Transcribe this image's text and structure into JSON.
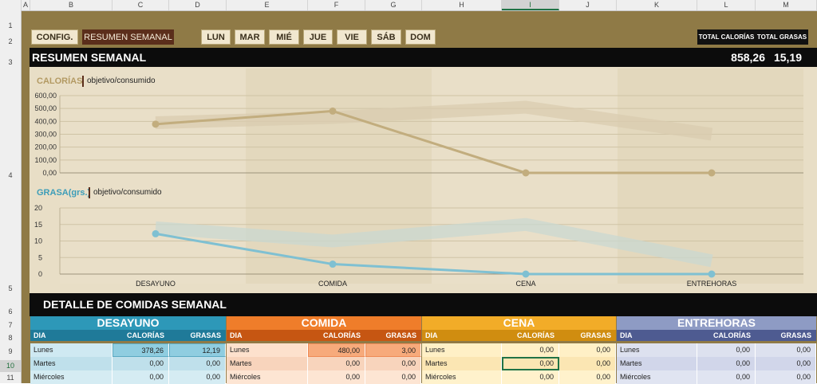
{
  "columns": [
    "A",
    "B",
    "C",
    "D",
    "E",
    "F",
    "G",
    "H",
    "I",
    "J",
    "K",
    "L",
    "M"
  ],
  "rows": [
    "1",
    "2",
    "3",
    "4",
    "5",
    "6",
    "7",
    "8",
    "9",
    "10",
    "11"
  ],
  "nav": {
    "config": "CONFIG.",
    "resumen": "RESUMEN SEMANAL",
    "days": [
      "LUN",
      "MAR",
      "MIÉ",
      "JUE",
      "VIE",
      "SÁB",
      "DOM"
    ]
  },
  "totals": {
    "cal_label": "TOTAL CALORÍAS",
    "fat_label": "TOTAL GRASAS",
    "cal_value": "858,26",
    "fat_value": "15,19"
  },
  "section_title": "RESUMEN SEMANAL",
  "detail_title": "DETALLE DE COMIDAS SEMANAL",
  "chart_data": [
    {
      "type": "line",
      "title": "CALORÍAS",
      "subtitle": "objetivo/consumido",
      "categories": [
        "DESAYUNO",
        "COMIDA",
        "CENA",
        "ENTREHORAS"
      ],
      "ylim": [
        0,
        600
      ],
      "yticks": [
        "0,00",
        "100,00",
        "200,00",
        "300,00",
        "400,00",
        "500,00",
        "600,00"
      ],
      "grid": true,
      "series": [
        {
          "role": "consumed",
          "values": [
            378.26,
            480,
            0,
            0
          ],
          "color": "#c2ad7e"
        },
        {
          "role": "target",
          "values": [
            390,
            430,
            510,
            300
          ],
          "color": "#d9ccb0"
        }
      ]
    },
    {
      "type": "line",
      "title": "GRASA(grs.)",
      "subtitle": "objetivo/consumido",
      "categories": [
        "DESAYUNO",
        "COMIDA",
        "CENA",
        "ENTREHORAS"
      ],
      "ylim": [
        0,
        20
      ],
      "yticks": [
        "0",
        "5",
        "10",
        "15",
        "20"
      ],
      "grid": true,
      "series": [
        {
          "role": "consumed",
          "values": [
            12.19,
            3,
            0,
            0
          ],
          "color": "#7fc0d2"
        },
        {
          "role": "target",
          "values": [
            14,
            10,
            15,
            4
          ],
          "color": "#c9d8d2"
        }
      ]
    }
  ],
  "colors": {
    "desayuno": "#2d98b8",
    "comida": "#ef7d2a",
    "cena": "#f2ac28",
    "entrehoras": "#8e9bc4"
  },
  "tables": [
    {
      "title": "DESAYUNO",
      "headers": [
        "DIA",
        "CALORÍAS",
        "GRASAS"
      ],
      "rows": [
        [
          "Lunes",
          "378,26",
          "12,19"
        ],
        [
          "Martes",
          "0,00",
          "0,00"
        ],
        [
          "Miércoles",
          "0,00",
          "0,00"
        ]
      ]
    },
    {
      "title": "COMIDA",
      "headers": [
        "DIA",
        "CALORÍAS",
        "GRASAS"
      ],
      "rows": [
        [
          "Lunes",
          "480,00",
          "3,00"
        ],
        [
          "Martes",
          "0,00",
          "0,00"
        ],
        [
          "Miércoles",
          "0,00",
          "0,00"
        ]
      ]
    },
    {
      "title": "CENA",
      "headers": [
        "DIA",
        "CALORÍAS",
        "GRASAS"
      ],
      "rows": [
        [
          "Lunes",
          "0,00",
          "0,00"
        ],
        [
          "Martes",
          "0,00",
          "0,00"
        ],
        [
          "Miércoles",
          "0,00",
          "0,00"
        ]
      ]
    },
    {
      "title": "ENTREHORAS",
      "headers": [
        "DIA",
        "CALORÍAS",
        "GRASAS"
      ],
      "rows": [
        [
          "Lunes",
          "0,00",
          "0,00"
        ],
        [
          "Martes",
          "0,00",
          "0,00"
        ],
        [
          "Miércoles",
          "0,00",
          "0,00"
        ]
      ]
    }
  ]
}
